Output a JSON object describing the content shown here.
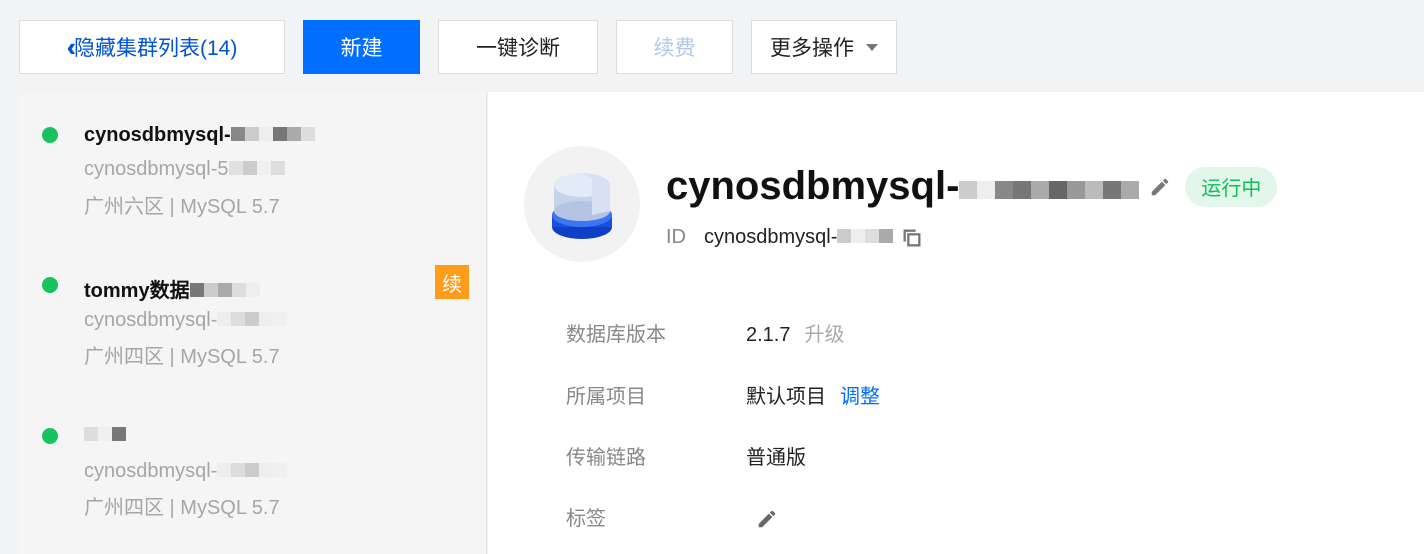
{
  "toolbar": {
    "hide_list_label": "隐藏集群列表(14)",
    "new_label": "新建",
    "diagnose_label": "一键诊断",
    "renew_label": "续费",
    "more_label": "更多操作"
  },
  "clusters": [
    {
      "name": "cynosdbmysql-",
      "id": "cynosdbmysql-5",
      "meta": "广州六区 | MySQL 5.7",
      "status_color": "#17c35f"
    },
    {
      "name": "tommy数据",
      "id": "cynosdbmysql-",
      "meta": "广州四区 | MySQL 5.7",
      "status_color": "#17c35f",
      "badge": "续"
    },
    {
      "name": "",
      "id": "cynosdbmysql-",
      "meta": "广州四区 | MySQL 5.7",
      "status_color": "#17c35f"
    }
  ],
  "detail": {
    "title": "cynosdbmysql-",
    "status": "运行中",
    "id_label": "ID",
    "id_value": "cynosdbmysql-",
    "rows": {
      "version": {
        "label": "数据库版本",
        "value": "2.1.7",
        "action": "升级"
      },
      "project": {
        "label": "所属项目",
        "value": "默认项目",
        "action": "调整"
      },
      "link": {
        "label": "传输链路",
        "value": "普通版"
      },
      "tags": {
        "label": "标签"
      }
    }
  },
  "colors": {
    "primary": "#006eff",
    "running": "#0abf5b",
    "renew_badge": "#ff9c19"
  }
}
